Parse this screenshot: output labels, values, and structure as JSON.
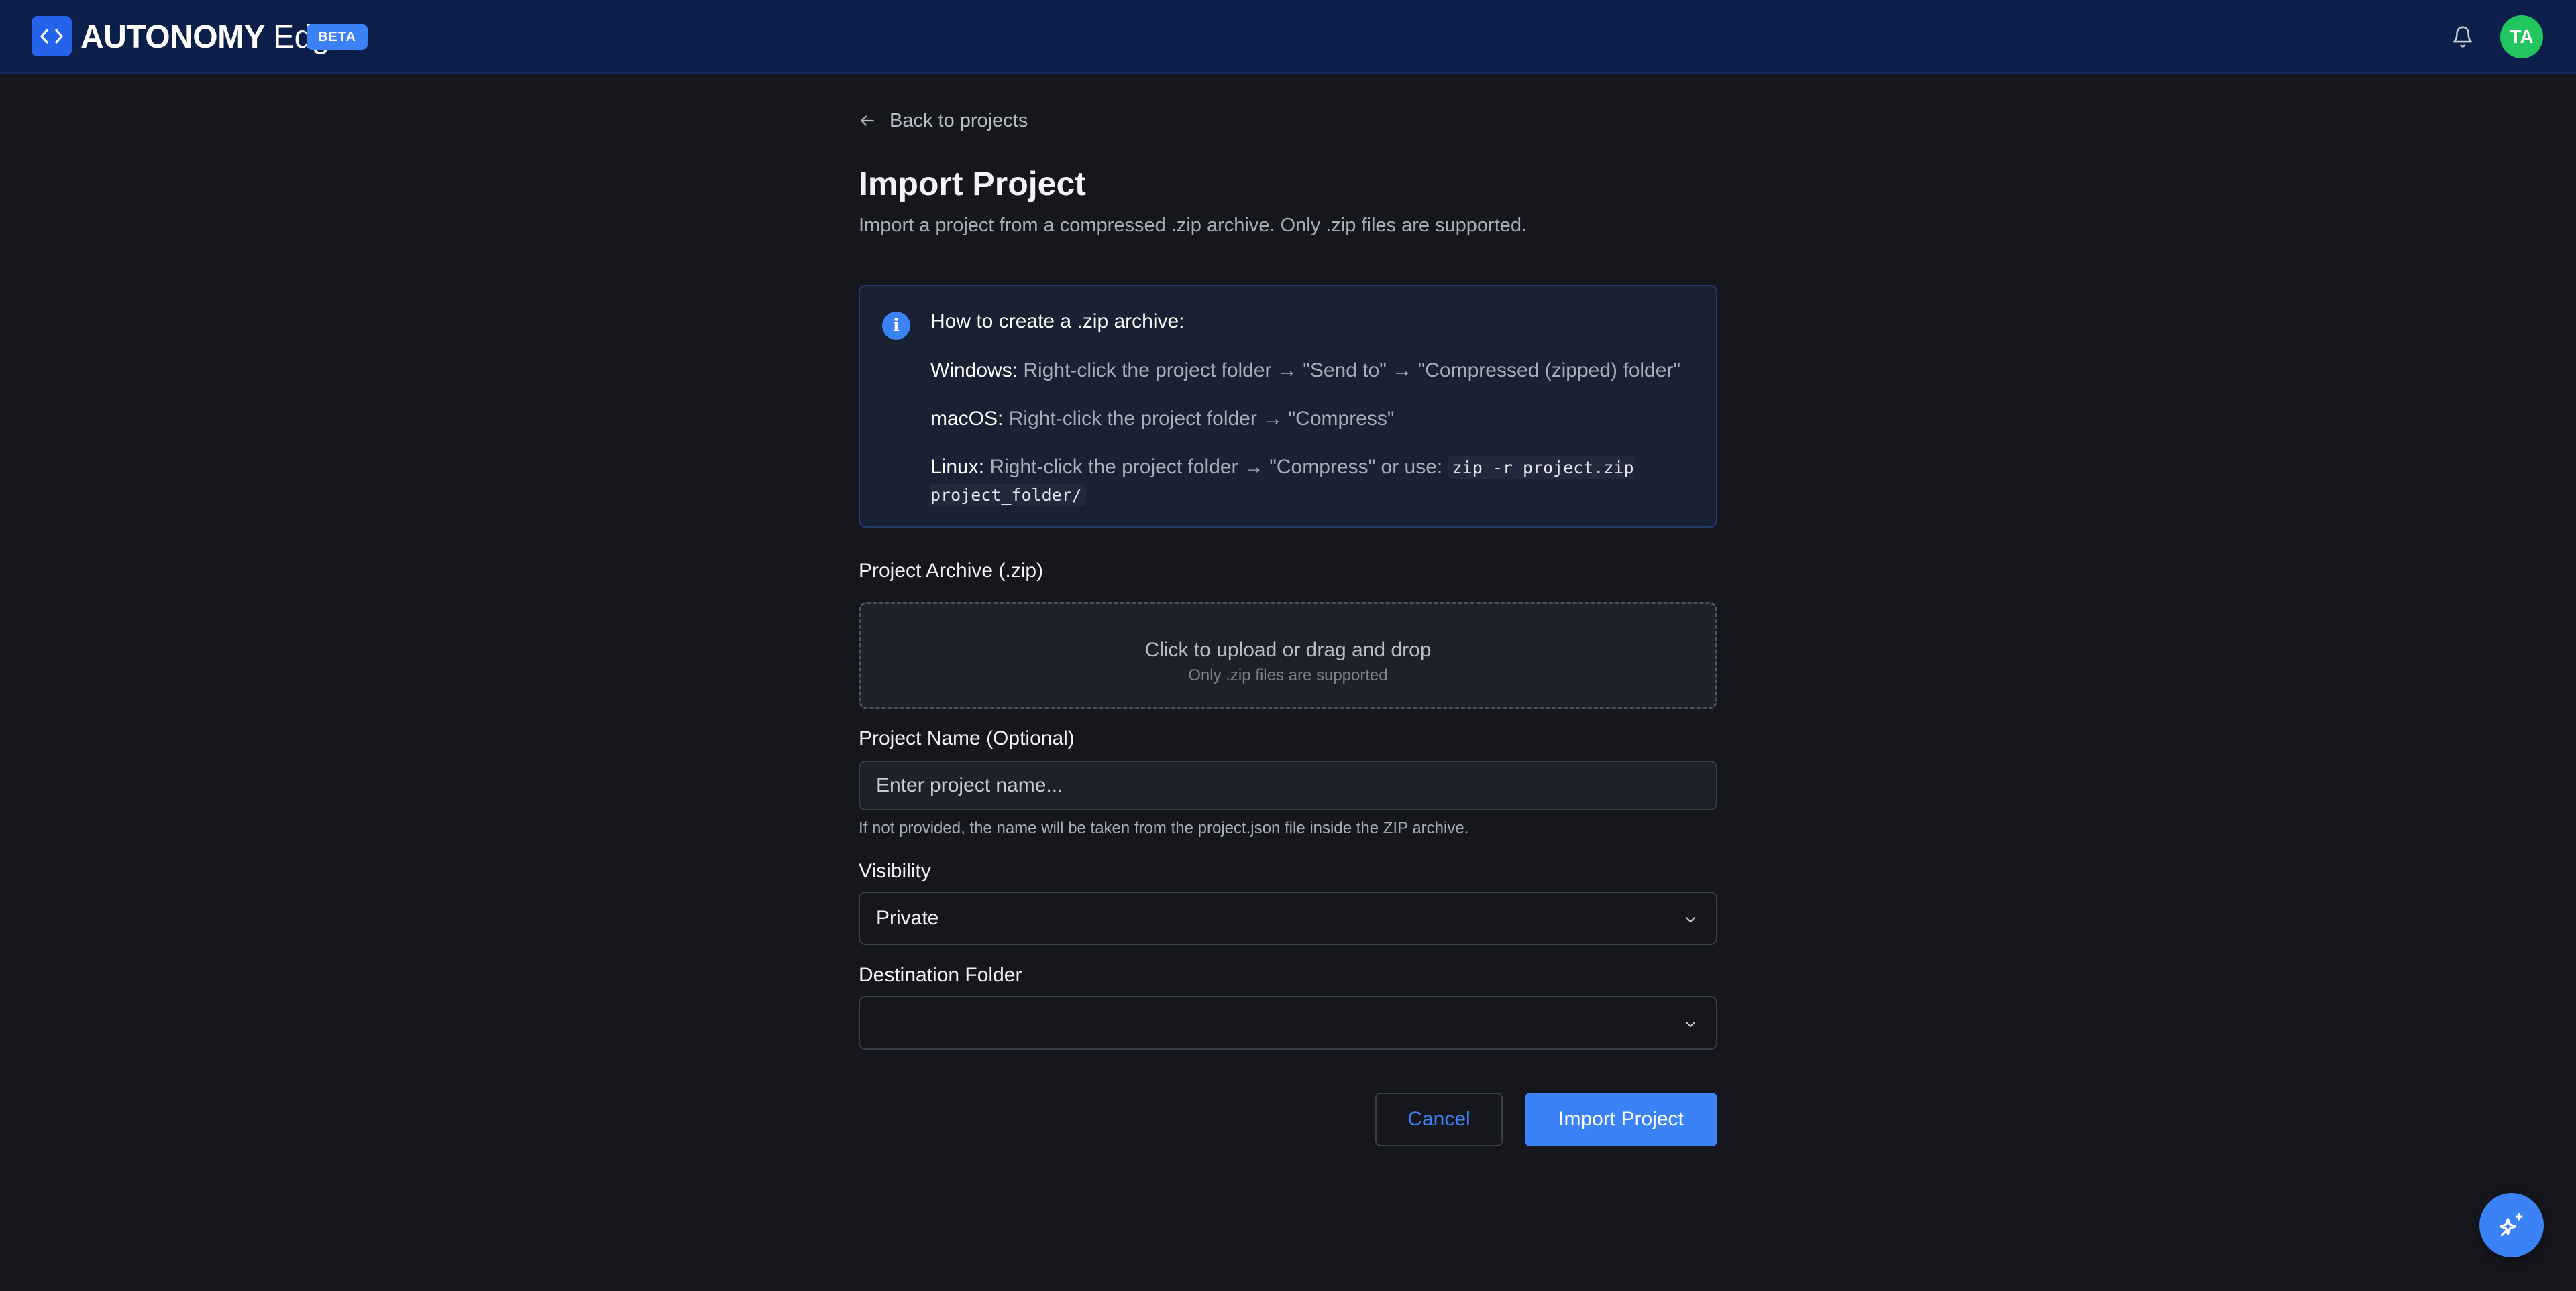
{
  "header": {
    "brand_strong": "AUTONOMY",
    "brand_light": "Edge",
    "badge": "BETA",
    "avatar_initials": "TA"
  },
  "back_link": "Back to projects",
  "page": {
    "title": "Import Project",
    "subtitle": "Import a project from a compressed .zip archive. Only .zip files are supported."
  },
  "info": {
    "title": "How to create a .zip archive:",
    "windows_label": "Windows:",
    "windows_text": " Right-click the project folder → \"Send to\" → \"Compressed (zipped) folder\"",
    "macos_label": "macOS:",
    "macos_text": " Right-click the project folder → \"Compress\"",
    "linux_label": "Linux:",
    "linux_text": " Right-click the project folder → \"Compress\" or use: ",
    "linux_code": "zip -r project.zip project_folder/"
  },
  "archive": {
    "label": "Project Archive (.zip)",
    "drop_main": "Click to upload or drag and drop",
    "drop_sub": "Only .zip files are supported"
  },
  "project_name": {
    "label": "Project Name (Optional)",
    "value": "",
    "placeholder": "Enter project name...",
    "help": "If not provided, the name will be taken from the project.json file inside the ZIP archive."
  },
  "visibility": {
    "label": "Visibility",
    "value": "Private"
  },
  "destination": {
    "label": "Destination Folder",
    "value": ""
  },
  "actions": {
    "cancel": "Cancel",
    "import": "Import Project"
  },
  "colors": {
    "accent": "#3b82f6",
    "topbar": "#0b1f4a",
    "background": "#15171c",
    "avatar": "#22c55e"
  },
  "icons": [
    "code-brackets-icon",
    "bell-icon",
    "arrow-left-icon",
    "info-icon",
    "chevron-down-icon",
    "sparkles-icon"
  ]
}
